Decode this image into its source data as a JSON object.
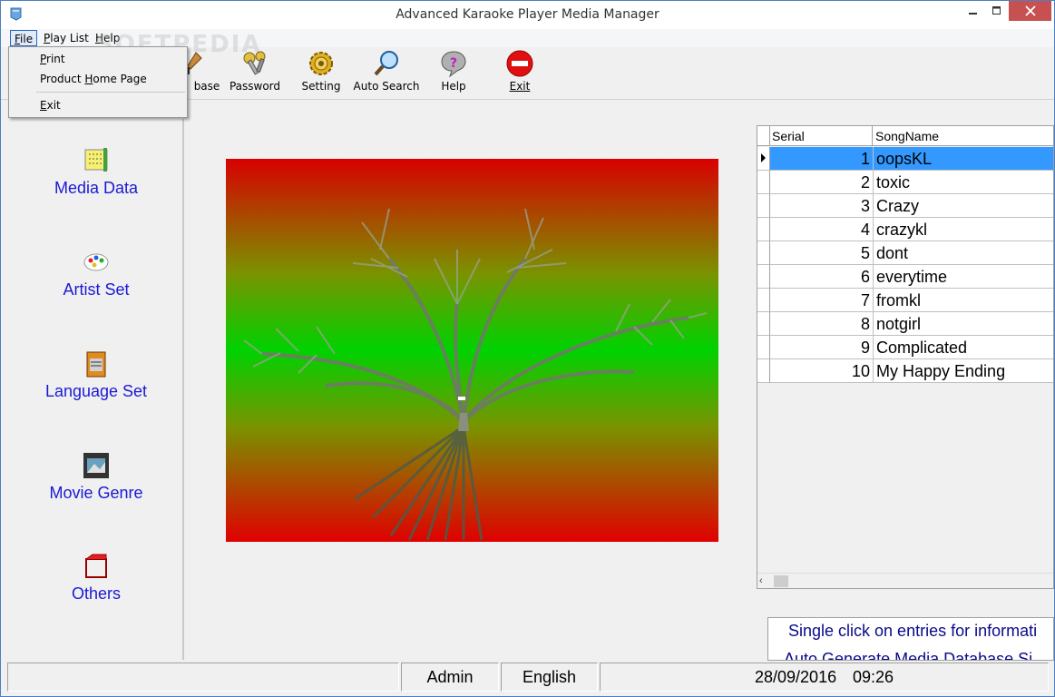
{
  "window": {
    "title": "Advanced Karaoke Player Media Manager"
  },
  "menu": {
    "file": "File",
    "playlist": "Play List",
    "help": "Help"
  },
  "watermark": "SOFTPEDIA",
  "file_menu": {
    "print": "Print",
    "home_page": "Product Home Page",
    "exit": "Exit"
  },
  "toolbar": {
    "database": "base",
    "password": "Password",
    "setting": "Setting",
    "auto_search": "Auto Search",
    "help": "Help",
    "exit": "Exit"
  },
  "nav": {
    "media_data": "Media Data",
    "artist_set": "Artist Set",
    "language_set": "Language Set",
    "movie_genre": "Movie Genre",
    "others": "Others"
  },
  "grid": {
    "columns": [
      "Serial",
      "SongName"
    ],
    "rows": [
      {
        "serial": "1",
        "song": "oopsKL"
      },
      {
        "serial": "2",
        "song": "toxic"
      },
      {
        "serial": "3",
        "song": "Crazy"
      },
      {
        "serial": "4",
        "song": "crazykl"
      },
      {
        "serial": "5",
        "song": "dont"
      },
      {
        "serial": "6",
        "song": "everytime"
      },
      {
        "serial": "7",
        "song": "fromkl"
      },
      {
        "serial": "8",
        "song": "notgirl"
      },
      {
        "serial": "9",
        "song": "Complicated"
      },
      {
        "serial": "10",
        "song": "My Happy Ending"
      }
    ],
    "selected_row": 0
  },
  "info": {
    "line1": "Single click on entries for informati",
    "line2": "Auto Generate Media Database Si"
  },
  "status": {
    "user": "Admin",
    "language": "English",
    "date": "28/09/2016",
    "time": "09:26"
  },
  "colors": {
    "selection": "#3399ff",
    "nav_text": "#1a1ad6",
    "close_button": "#c75050"
  }
}
